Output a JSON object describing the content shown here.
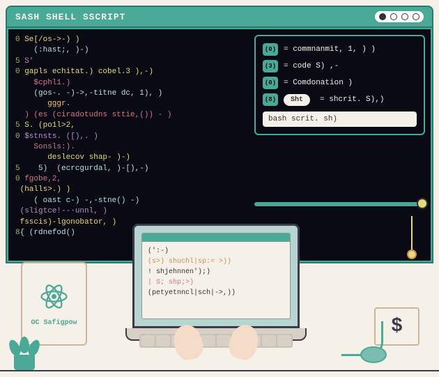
{
  "window": {
    "title": "SASH SHELL SSCRIPT"
  },
  "terminal": {
    "lines": [
      {
        "ln": "0",
        "t": " Se[/os->-) )"
      },
      {
        "ln": "",
        "t": "    (:hast;, )-)"
      },
      {
        "ln": "5",
        "t": " S'"
      },
      {
        "ln": "0",
        "t": " gapls echitat.) cobel.3 ),-)"
      },
      {
        "ln": "",
        "t": "    $cphl1.)"
      },
      {
        "ln": "",
        "t": "    (gos-. -)->,-titne dc, 1), )"
      },
      {
        "ln": "",
        "t": "       gggr."
      },
      {
        "ln": "",
        "t": "  ) (es (ciradotudns sttie,()) - )"
      },
      {
        "ln": "5",
        "t": " S. (po1l>2,"
      },
      {
        "ln": "0",
        "t": " $stnsts. ([),. )"
      },
      {
        "ln": "",
        "t": "    Sonsls:)."
      },
      {
        "ln": "",
        "t": "       deslecov shap- )-)"
      },
      {
        "ln": "5",
        "t": "    5)  (ecrcgurdal, )-[),-)"
      },
      {
        "ln": "0",
        "t": " fgobe,2,"
      },
      {
        "ln": "",
        "t": " (halls>.) )"
      },
      {
        "ln": "",
        "t": "    ( oast c-) -,-stne() -)"
      },
      {
        "ln": "",
        "t": " (sligtce!--·unnl, )"
      },
      {
        "ln": "",
        "t": " fsscis)-lgonobator, )"
      },
      {
        "ln": "8",
        "t": "{ (rdnefod()"
      }
    ]
  },
  "panel": {
    "rows": [
      {
        "badge": "(0)",
        "text": "= commnanmit, 1, ) )"
      },
      {
        "badge": "(3)",
        "text": "= code S) ,-"
      },
      {
        "badge": "(0)",
        "text": "= Comdonation )"
      },
      {
        "badge": "(8)",
        "pill": "Sht",
        "text": "= shcrit. S),)"
      }
    ],
    "input": "bash scrit. sh)"
  },
  "laptop": {
    "lines": [
      "(':-)",
      "(s>) shuchl|sp:= >))",
      "!   shjehnnen');)",
      "| S; shp;>)",
      "(petyetnncl|sch|->,))"
    ]
  },
  "badge": {
    "label": "OC Safigpow"
  },
  "dollar": {
    "symbol": "$"
  }
}
